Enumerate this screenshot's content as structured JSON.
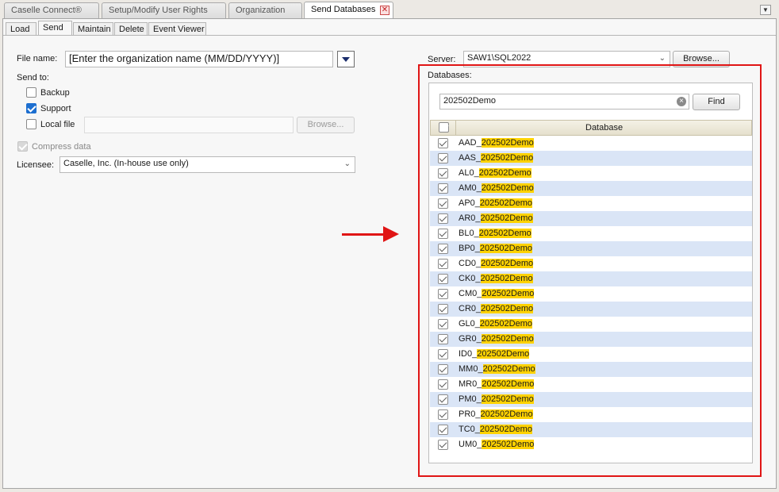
{
  "doc_tabs": [
    {
      "label": "Caselle Connect®"
    },
    {
      "label": "Setup/Modify User Rights"
    },
    {
      "label": "Organization"
    },
    {
      "label": "Send Databases"
    }
  ],
  "sub_tabs": [
    {
      "label": "Load"
    },
    {
      "label": "Send"
    },
    {
      "label": "Maintain"
    },
    {
      "label": "Delete"
    },
    {
      "label": "Event Viewer"
    }
  ],
  "form": {
    "file_name_label": "File name:",
    "file_name_value": "[Enter the organization name (MM/DD/YYYY)]",
    "send_to_label": "Send to:",
    "backup_label": "Backup",
    "support_label": "Support",
    "local_file_label": "Local file",
    "browse_label": "Browse...",
    "compress_label": "Compress data",
    "licensee_label": "Licensee:",
    "licensee_value": "Caselle, Inc. (In-house use only)"
  },
  "server": {
    "label": "Server:",
    "value": "SAW1\\SQL2022",
    "browse_label": "Browse..."
  },
  "databases": {
    "label": "Databases:",
    "search_value": "202502Demo",
    "find_label": "Find",
    "column_header": "Database",
    "rows": [
      {
        "prefix": "AAD_",
        "match": "202502Demo"
      },
      {
        "prefix": "AAS_",
        "match": "202502Demo"
      },
      {
        "prefix": "AL0_",
        "match": "202502Demo"
      },
      {
        "prefix": "AM0_",
        "match": "202502Demo"
      },
      {
        "prefix": "AP0_",
        "match": "202502Demo"
      },
      {
        "prefix": "AR0_",
        "match": "202502Demo"
      },
      {
        "prefix": "BL0_",
        "match": "202502Demo"
      },
      {
        "prefix": "BP0_",
        "match": "202502Demo"
      },
      {
        "prefix": "CD0_",
        "match": "202502Demo"
      },
      {
        "prefix": "CK0_",
        "match": "202502Demo"
      },
      {
        "prefix": "CM0_",
        "match": "202502Demo"
      },
      {
        "prefix": "CR0_",
        "match": "202502Demo"
      },
      {
        "prefix": "GL0_",
        "match": "202502Demo"
      },
      {
        "prefix": "GR0_",
        "match": "202502Demo"
      },
      {
        "prefix": "ID0_",
        "match": "202502Demo"
      },
      {
        "prefix": "MM0_",
        "match": "202502Demo"
      },
      {
        "prefix": "MR0_",
        "match": "202502Demo"
      },
      {
        "prefix": "PM0_",
        "match": "202502Demo"
      },
      {
        "prefix": "PR0_",
        "match": "202502Demo"
      },
      {
        "prefix": "TC0_",
        "match": "202502Demo"
      },
      {
        "prefix": "UM0_",
        "match": "202502Demo"
      }
    ]
  },
  "colors": {
    "annotation": "#e01515",
    "match_highlight": "#ffd200",
    "alt_row": "#dae5f6"
  }
}
